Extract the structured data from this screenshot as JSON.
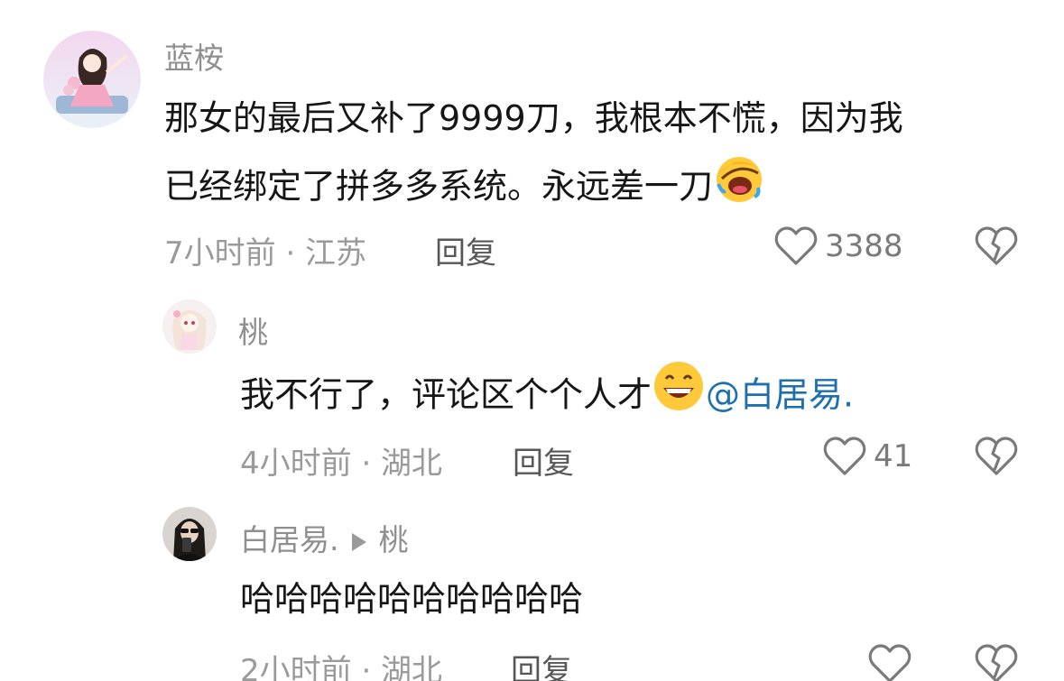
{
  "comments": [
    {
      "username": "蓝桉",
      "line1": "那女的最后又补了9999刀，我根本不慌，因为我",
      "line2": "已经绑定了拼多多系统。永远差一刀",
      "time": "7小时前 · 江苏",
      "reply_label": "回复",
      "likes": "3388",
      "emoji": "laughing-face-emoji"
    },
    {
      "username": "桃",
      "text": "我不行了，评论区个个人才",
      "mention": "@白居易.",
      "time": "4小时前 · 湖北",
      "reply_label": "回复",
      "likes": "41",
      "emoji": "grinning-face-emoji"
    },
    {
      "username": "白居易.",
      "reply_to": "桃",
      "text": "哈哈哈哈哈哈哈哈哈哈",
      "time": "2小时前 · 湖北",
      "reply_label": "回复",
      "likes": ""
    }
  ],
  "icons": {
    "like": "heart-outline-icon",
    "dislike": "broken-heart-icon",
    "reply_arrow": "play-arrow-icon"
  },
  "colors": {
    "mention": "#1e6fb0",
    "meta": "#9a9a9a",
    "username": "#8f8f8f"
  }
}
